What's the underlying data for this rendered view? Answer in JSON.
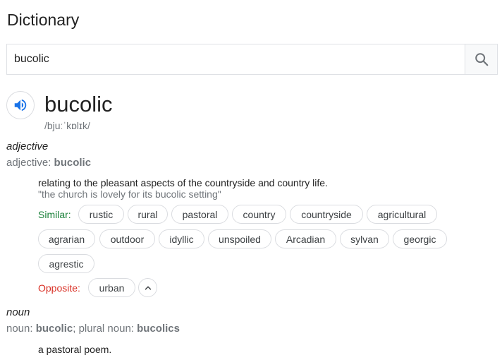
{
  "header": {
    "title": "Dictionary"
  },
  "search": {
    "value": "bucolic"
  },
  "entry": {
    "word": "bucolic",
    "phonetic": "/bjuːˈkɒlɪk/",
    "senses": [
      {
        "pos": "adjective",
        "pos_prefix": "adjective:",
        "pos_word": "bucolic",
        "definition": "relating to the pleasant aspects of the countryside and country life.",
        "example": "\"the church is lovely for its bucolic setting\"",
        "similar_label": "Similar:",
        "similar": [
          "rustic",
          "rural",
          "pastoral",
          "country",
          "countryside",
          "agricultural",
          "agrarian",
          "outdoor",
          "idyllic",
          "unspoiled",
          "Arcadian",
          "sylvan",
          "georgic",
          "agrestic"
        ],
        "opposite_label": "Opposite:",
        "opposite": [
          "urban"
        ]
      },
      {
        "pos": "noun",
        "pos_prefix": "noun:",
        "pos_word": "bucolic",
        "plural_sep": "; plural noun:",
        "plural_word": "bucolics",
        "definition": "a pastoral poem."
      }
    ]
  },
  "colors": {
    "similar": "#188038",
    "opposite": "#d93025",
    "speaker": "#1a73e8"
  },
  "icons": {
    "search": "search-icon",
    "speaker": "speaker-icon",
    "expand": "chevron-up-icon"
  }
}
